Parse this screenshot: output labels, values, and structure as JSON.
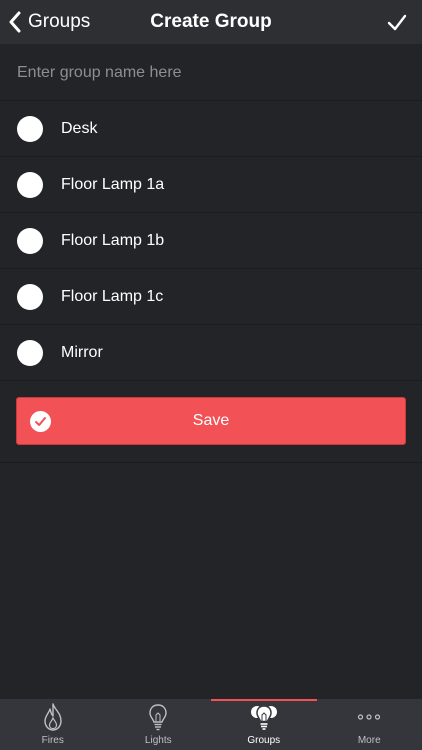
{
  "nav": {
    "back_label": "Groups",
    "title": "Create Group",
    "confirm_icon": "checkmark-icon"
  },
  "group_name": {
    "value": "",
    "placeholder": "Enter group name here"
  },
  "lights": [
    {
      "label": "Desk",
      "selected": false
    },
    {
      "label": "Floor Lamp 1a",
      "selected": false
    },
    {
      "label": "Floor Lamp 1b",
      "selected": false
    },
    {
      "label": "Floor Lamp 1c",
      "selected": false
    },
    {
      "label": "Mirror",
      "selected": false
    }
  ],
  "save_button": {
    "label": "Save",
    "icon": "check-circle-icon"
  },
  "tabs": [
    {
      "label": "Fires",
      "icon": "flame-icon",
      "active": false
    },
    {
      "label": "Lights",
      "icon": "lightbulb-icon",
      "active": false
    },
    {
      "label": "Groups",
      "icon": "bulb-group-icon",
      "active": true
    },
    {
      "label": "More",
      "icon": "more-dots-icon",
      "active": false
    }
  ],
  "colors": {
    "background": "#232428",
    "navbar": "#2e2f33",
    "accent": "#f25155",
    "tabbar": "#35363b",
    "text": "#ffffff",
    "placeholder": "#8d8e94"
  }
}
